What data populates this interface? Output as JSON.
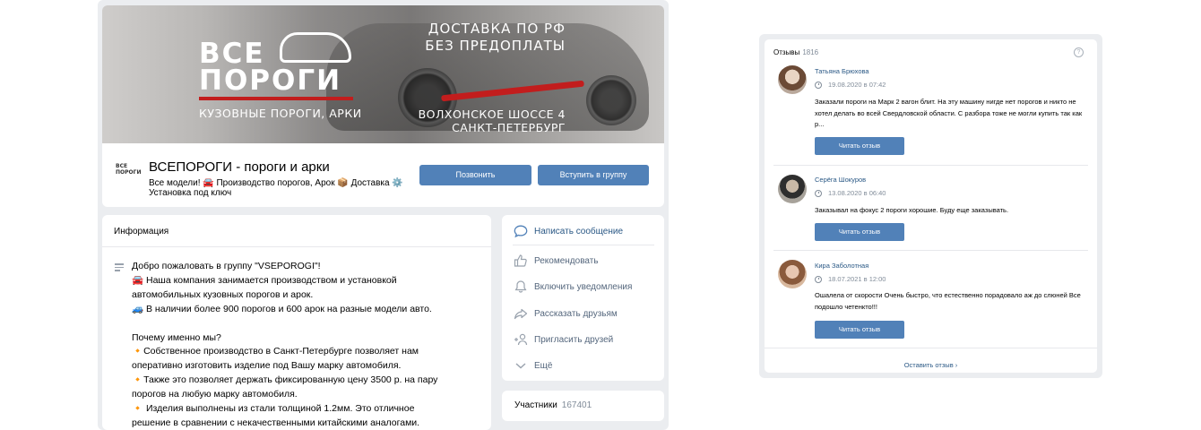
{
  "group": {
    "cover": {
      "brand_line1": "ВСЕ",
      "brand_line2": "ПОРОГИ",
      "brand_tagline": "КУЗОВНЫЕ ПОРОГИ, АРКИ",
      "delivery_line1": "ДОСТАВКА ПО РФ",
      "delivery_line2": "БЕЗ ПРЕДОПЛАТЫ",
      "address_line1": "ВОЛХОНСКОЕ ШОССЕ 4",
      "address_line2": "САНКТ-ПЕТЕРБУРГ"
    },
    "logo_line1": "ВСЕ",
    "logo_line2": "ПОРОГИ",
    "name": "ВСЕПОРОГИ - пороги и арки",
    "status": "Все модели! 🚘 Производство порогов, Арок 📦 Доставка ⚙️ Установка под ключ",
    "call_button": "Позвонить",
    "join_button": "Вступить в группу"
  },
  "info": {
    "title": "Информация",
    "lines": [
      "Добро пожаловать в группу \"VSEPOROGI\"!",
      "🚘 Наша компания занимается производством и установкой",
      "автомобильных кузовных порогов и арок.",
      "🚙 В наличии более 900 порогов и 600 арок на разные модели авто.",
      "",
      "Почему именно мы?",
      "🔸Собственное производство в Санкт-Петербурге позволяет нам",
      "оперативно изготовить изделие под Вашу марку автомобиля.",
      "🔸Также это позволяет держать фиксированную цену 3500 р. на пару",
      "порогов на любую марку автомобиля.",
      "🔸 Изделия выполнены из стали толщиной 1.2мм. Это отличное",
      "решение в сравнении с некачественными китайскими аналогами."
    ]
  },
  "actions": {
    "message": "Написать сообщение",
    "recommend": "Рекомендовать",
    "notifications": "Включить уведомления",
    "share": "Рассказать друзьям",
    "invite": "Пригласить друзей",
    "more": "Ещё"
  },
  "members": {
    "label": "Участники",
    "count": "167401"
  },
  "reviews": {
    "title": "Отзывы",
    "count": "1816",
    "help": "?",
    "items": [
      {
        "name": "Татьяна Брюхова",
        "date": "19.08.2020 в 07:42",
        "text": "Заказали пороги на Марк 2 вагон блит. На эту машину нигде нет порогов и никто не хотел делать во всей Свердловской области. С разбора тоже не могли купить так как р...",
        "button": "Читать отзыв"
      },
      {
        "name": "Серёга Шокуров",
        "date": "13.08.2020 в 06:40",
        "text": "Заказывал на фокус 2 пороги хорошие. Буду еще заказывать.",
        "button": "Читать отзыв"
      },
      {
        "name": "Кира Заболотная",
        "date": "18.07.2021 в 12:00",
        "text": "Ошалела от скорости Очень быстро, что естественно порадовало аж до слюней Все подошло четенкто!!!",
        "button": "Читать отзыв"
      }
    ],
    "leave_link": "Оставить отзыв ›"
  }
}
